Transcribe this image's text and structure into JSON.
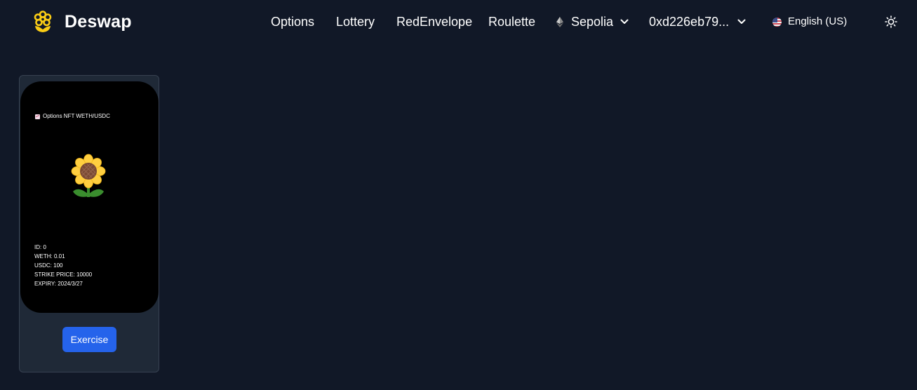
{
  "brand": {
    "name": "Deswap",
    "logo_icon": "flower-logo-icon",
    "logo_color": "#facc15"
  },
  "nav": {
    "links": [
      {
        "label": "Options"
      },
      {
        "label": "Lottery"
      },
      {
        "label": "RedEnvelope"
      },
      {
        "label": "Roulette"
      }
    ],
    "network": {
      "label": "Sepolia",
      "icon": "ethereum-icon"
    },
    "account": {
      "label": "0xd226eb79..."
    },
    "language": {
      "label": "English (US)",
      "icon": "us-flag-icon"
    },
    "theme_toggle": {
      "icon": "sun-icon"
    }
  },
  "nft_card": {
    "title": "Options NFT WETH/USDC",
    "title_icon": "chart-icon",
    "image_icon": "sunflower-icon",
    "details": [
      "ID: 0",
      "WETH: 0.01",
      "USDC: 100",
      "STRIKE PRICE: 10000",
      "EXPIRY: 2024/3/27"
    ],
    "action_label": "Exercise"
  },
  "colors": {
    "background": "#111827",
    "card": "#1f2937",
    "nft_background": "#000000",
    "primary_button": "#2563eb"
  }
}
